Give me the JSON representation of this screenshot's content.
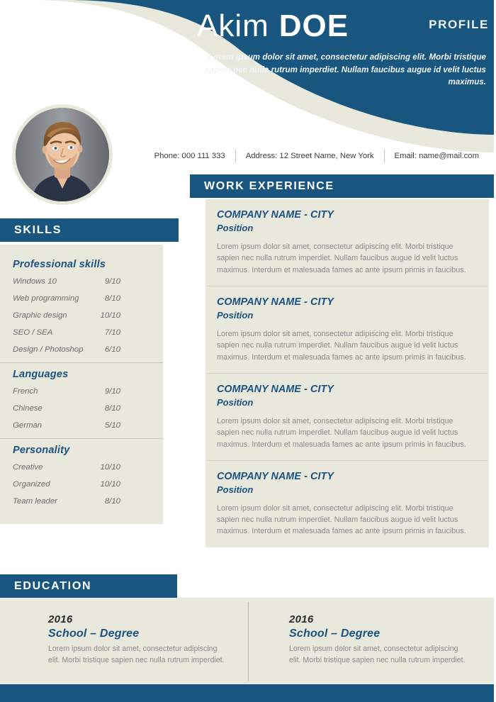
{
  "colors": {
    "brand_blue": "#18567f",
    "beige": "#e8e8dd",
    "heading_blue": "#1b5280",
    "body_gray": "#8b8b8b"
  },
  "header": {
    "first_name": "Akim",
    "last_name": "DOE",
    "profile_label": "PROFILE",
    "summary": "Lorem ipsum dolor sit amet, consectetur adipiscing elit. Morbi tristique sapien nec nulla rutrum imperdiet. Nullam faucibus augue id velit luctus maximus.",
    "avatar_alt": "profile-photo"
  },
  "contact": {
    "phone": "Phone: 000 111 333",
    "address": "Address: 12 Street Name, New York",
    "email": "Email: name@mail.com"
  },
  "skills": {
    "section_title": "SKILLS",
    "groups": [
      {
        "title": "Professional skills",
        "items": [
          {
            "label": "Windows 10",
            "value": "9/10"
          },
          {
            "label": "Web programming",
            "value": "8/10"
          },
          {
            "label": "Graphic design",
            "value": "10/10"
          },
          {
            "label": "SEO / SEA",
            "value": "7/10"
          },
          {
            "label": "Design /  Photoshop",
            "value": "6/10"
          }
        ]
      },
      {
        "title": "Languages",
        "items": [
          {
            "label": "French",
            "value": "9/10"
          },
          {
            "label": "Chinese",
            "value": "8/10"
          },
          {
            "label": "German",
            "value": "5/10"
          }
        ]
      },
      {
        "title": "Personality",
        "items": [
          {
            "label": "Creative",
            "value": "10/10"
          },
          {
            "label": "Organized",
            "value": "10/10"
          },
          {
            "label": "Team leader",
            "value": "8/10"
          }
        ]
      }
    ]
  },
  "work": {
    "section_title": "WORK EXPERIENCE",
    "items": [
      {
        "company": "COMPANY NAME - CITY",
        "position": "Position",
        "description": "Lorem ipsum dolor sit amet, consectetur adipiscing elit. Morbi tristique sapien nec nulla rutrum imperdiet. Nullam faucibus augue id velit luctus maximus. Interdum et malesuada fames ac ante ipsum primis in faucibus."
      },
      {
        "company": "COMPANY NAME - CITY",
        "position": "Position",
        "description": "Lorem ipsum dolor sit amet, consectetur adipiscing elit. Morbi tristique sapien nec nulla rutrum imperdiet. Nullam faucibus augue id velit luctus maximus. Interdum et malesuada fames ac ante ipsum primis in faucibus."
      },
      {
        "company": "COMPANY NAME - CITY",
        "position": "Position",
        "description": "Lorem ipsum dolor sit amet, consectetur adipiscing elit. Morbi tristique sapien nec nulla rutrum imperdiet. Nullam faucibus augue id velit luctus maximus. Interdum et malesuada fames ac ante ipsum primis in faucibus."
      },
      {
        "company": "COMPANY NAME - CITY",
        "position": "Position",
        "description": "Lorem ipsum dolor sit amet, consectetur adipiscing elit. Morbi tristique sapien nec nulla rutrum imperdiet. Nullam faucibus augue id velit luctus maximus. Interdum et malesuada fames ac ante ipsum primis in faucibus."
      }
    ]
  },
  "education": {
    "section_title": "EDUCATION",
    "items": [
      {
        "year": "2016",
        "school": "School – Degree",
        "description": "Lorem ipsum dolor sit amet, consectetur adipiscing elit. Morbi tristique sapien nec nulla rutrum imperdiet."
      },
      {
        "year": "2016",
        "school": "School – Degree",
        "description": "Lorem ipsum dolor sit amet, consectetur adipiscing elit. Morbi tristique sapien nec nulla rutrum imperdiet."
      }
    ]
  }
}
